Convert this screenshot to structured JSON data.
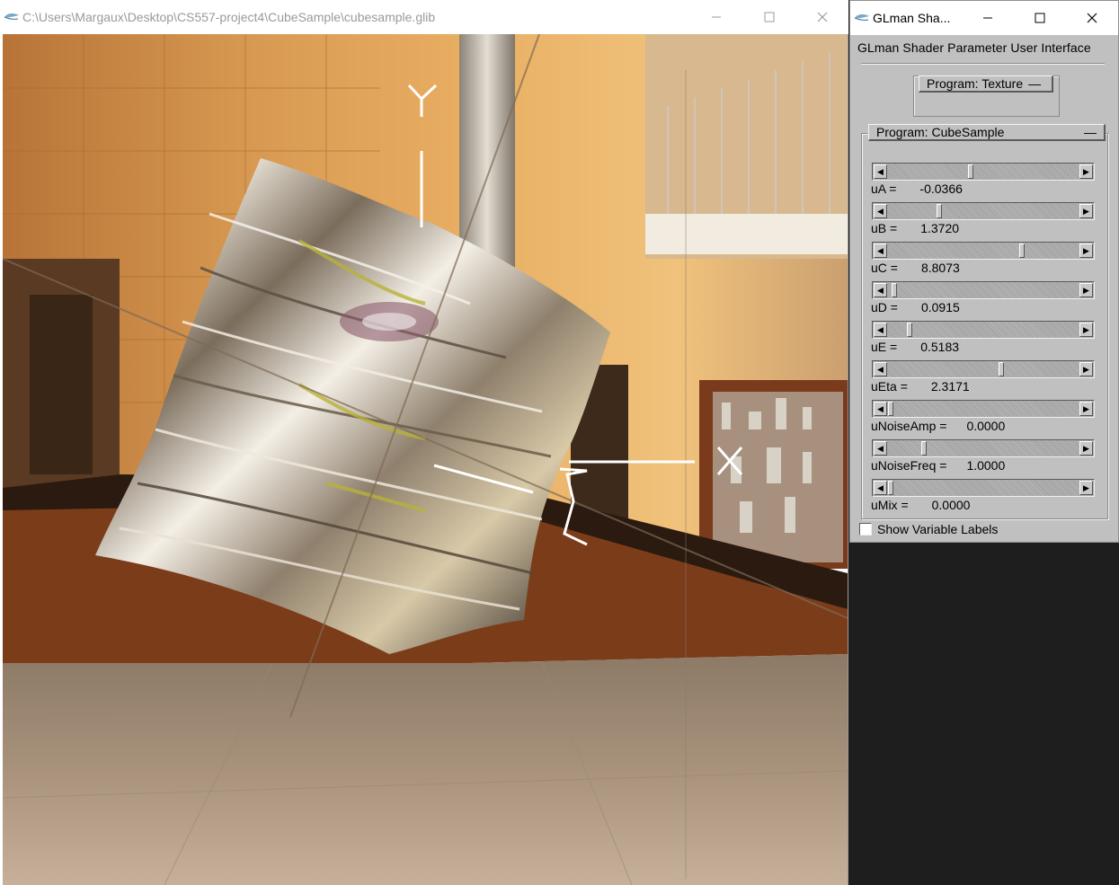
{
  "viewer": {
    "title": "C:\\Users\\Margaux\\Desktop\\CS557-project4\\CubeSample\\cubesample.glib",
    "axis_labels": {
      "x": "X",
      "y": "Y",
      "z": "Z"
    }
  },
  "glman": {
    "title": "GLman Sha...",
    "ui_title": "GLman Shader Parameter User Interface",
    "program_texture": "Program: Texture",
    "program_cube": "Program: CubeSample",
    "listbox_mark": "—",
    "sliders": [
      {
        "name": "uA =",
        "value": "-0.0366",
        "fraction": 0.43
      },
      {
        "name": "uB =",
        "value": "1.3720",
        "fraction": 0.26
      },
      {
        "name": "uC =",
        "value": "8.8073",
        "fraction": 0.7
      },
      {
        "name": "uD =",
        "value": "0.0915",
        "fraction": 0.02
      },
      {
        "name": "uE =",
        "value": "0.5183",
        "fraction": 0.1
      },
      {
        "name": "uEta =",
        "value": "2.3171",
        "fraction": 0.59
      },
      {
        "name": "uNoiseAmp =",
        "value": "0.0000",
        "fraction": 0.0
      },
      {
        "name": "uNoiseFreq =",
        "value": "1.0000",
        "fraction": 0.18
      },
      {
        "name": "uMix =",
        "value": "0.0000",
        "fraction": 0.0
      }
    ],
    "show_variable_labels": "Show Variable Labels",
    "show_variable_labels_checked": false
  }
}
